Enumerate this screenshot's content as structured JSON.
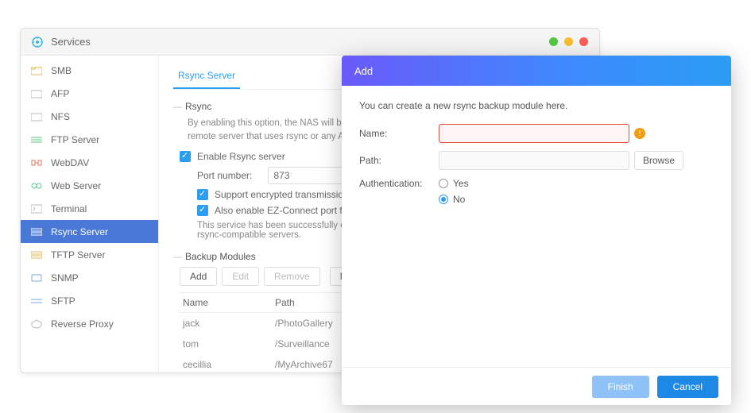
{
  "window": {
    "title": "Services"
  },
  "sidebar": {
    "items": [
      {
        "label": "SMB",
        "icon": "folder"
      },
      {
        "label": "AFP",
        "icon": "folder2"
      },
      {
        "label": "NFS",
        "icon": "folder3"
      },
      {
        "label": "FTP Server",
        "icon": "ftp"
      },
      {
        "label": "WebDAV",
        "icon": "webdav"
      },
      {
        "label": "Web Server",
        "icon": "webserver"
      },
      {
        "label": "Terminal",
        "icon": "terminal"
      },
      {
        "label": "Rsync Server",
        "icon": "rsync"
      },
      {
        "label": "TFTP Server",
        "icon": "tftp"
      },
      {
        "label": "SNMP",
        "icon": "snmp"
      },
      {
        "label": "SFTP",
        "icon": "sftp"
      },
      {
        "label": "Reverse Proxy",
        "icon": "proxy"
      }
    ],
    "active_index": 7
  },
  "tab": {
    "label": "Rsync Server"
  },
  "rsync": {
    "section_title": "Rsync",
    "description": "By enabling this option, the NAS will become a backup server and can receive data from another remote server that uses rsync or any ADM-compatible servers.",
    "enable_label": "Enable Rsync server",
    "port_label": "Port number:",
    "port_value": "873",
    "ssh_label": "Support encrypted transmission via SSH",
    "ezconnect_label": "Also enable EZ-Connect port forwarding",
    "status": "This service has been successfully enabled. You can now back up your NAS from remote rsync-compatible servers."
  },
  "backup": {
    "section_title": "Backup Modules",
    "buttons": {
      "add": "Add",
      "edit": "Edit",
      "remove": "Remove",
      "manage": "Manage User"
    },
    "columns": {
      "name": "Name",
      "path": "Path"
    },
    "rows": [
      {
        "name": "jack",
        "path": "/PhotoGallery"
      },
      {
        "name": "tom",
        "path": "/Surveillance"
      },
      {
        "name": "cecillia",
        "path": "/MyArchive67"
      }
    ]
  },
  "modal": {
    "title": "Add",
    "intro": "You can create a new rsync backup module here.",
    "labels": {
      "name": "Name:",
      "path": "Path:",
      "auth": "Authentication:",
      "browse": "Browse",
      "yes": "Yes",
      "no": "No"
    },
    "values": {
      "name": "",
      "path": ""
    },
    "auth_selected": "no",
    "buttons": {
      "finish": "Finish",
      "cancel": "Cancel"
    }
  }
}
